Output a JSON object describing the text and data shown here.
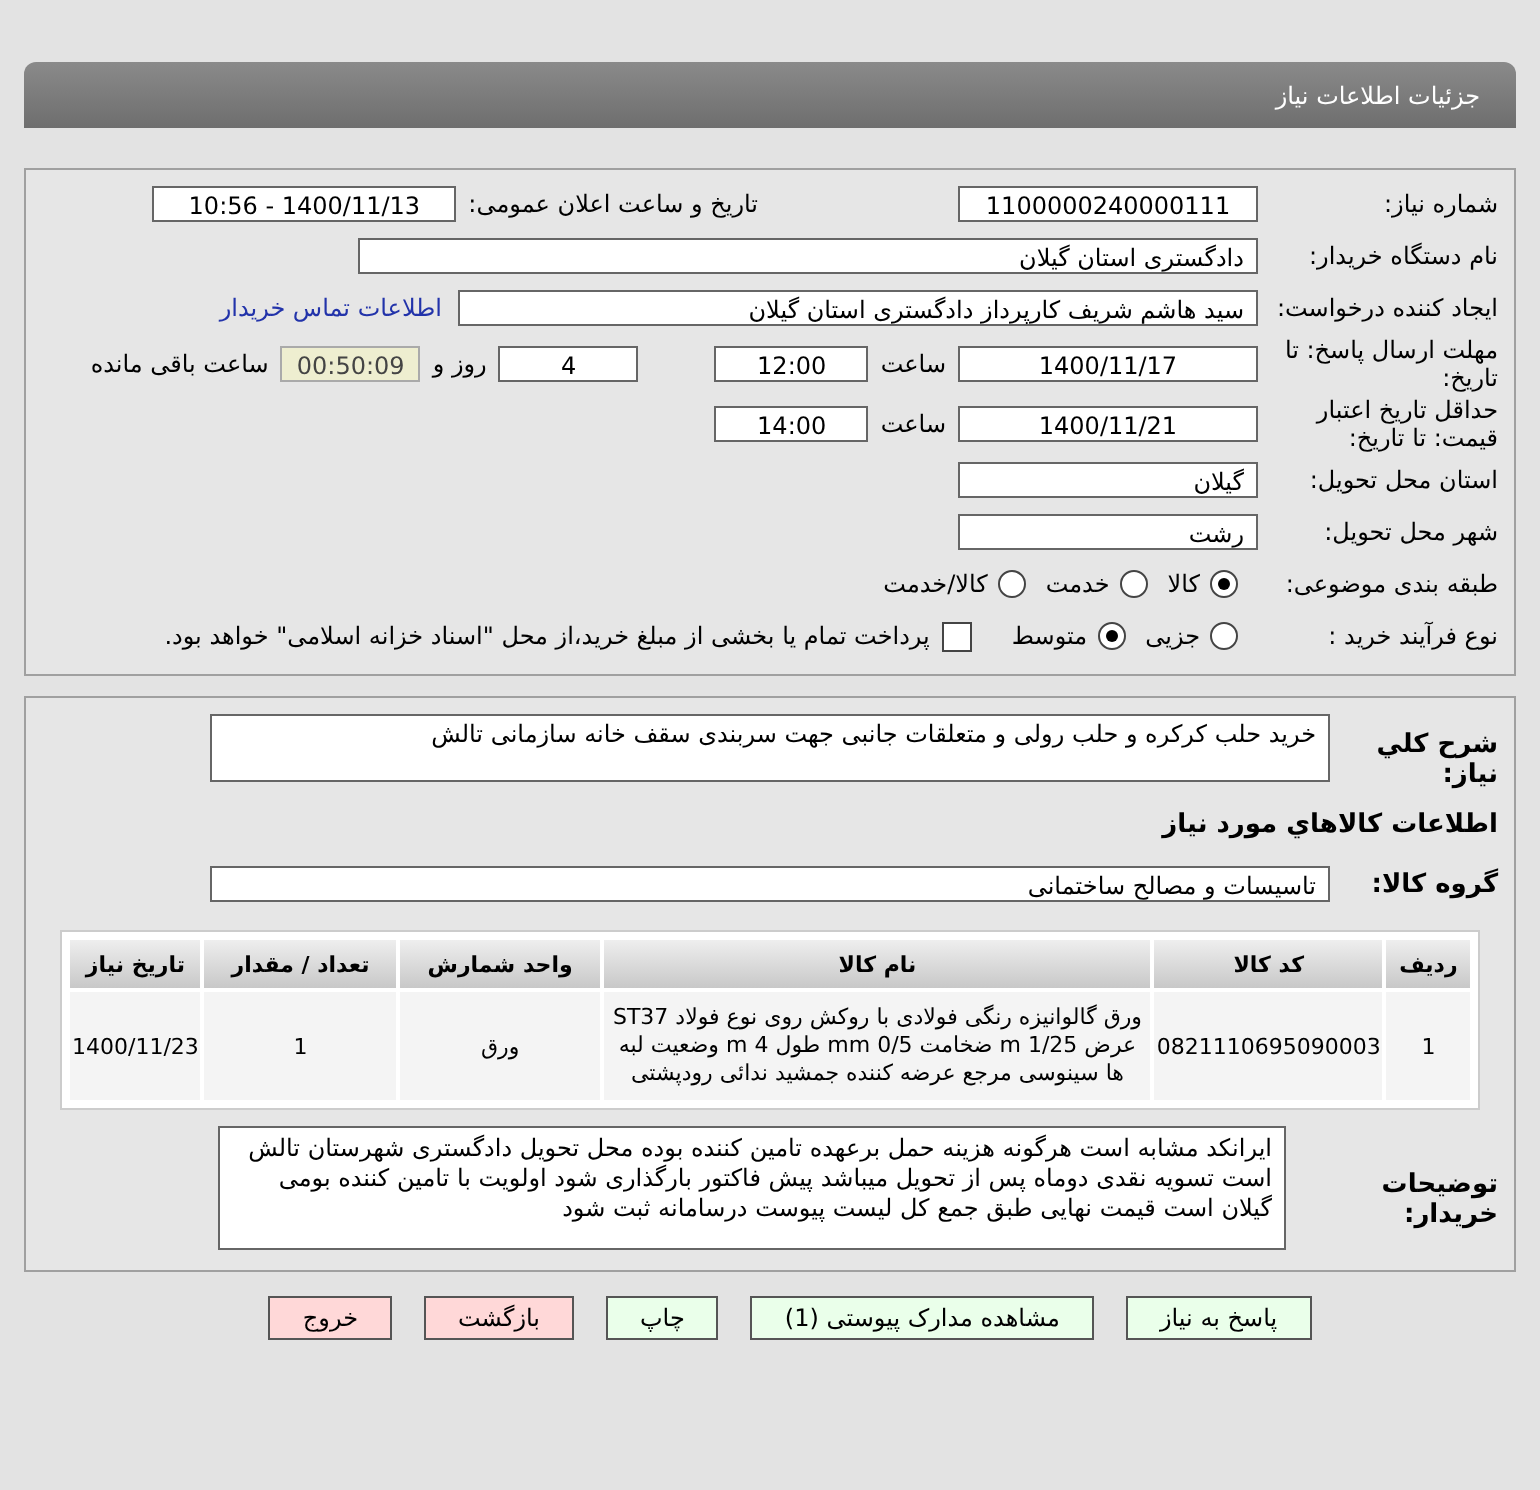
{
  "header": {
    "title": "جزئیات اطلاعات نیاز"
  },
  "details": {
    "need_number": {
      "label": "شماره نیاز:",
      "value": "1100000240000111"
    },
    "announce": {
      "label": "تاریخ و ساعت اعلان عمومی:",
      "value": "1400/11/13 - 10:56"
    },
    "buyer_org": {
      "label": "نام دستگاه خریدار:",
      "value": "دادگستری استان گیلان"
    },
    "requester": {
      "label": "ایجاد کننده درخواست:",
      "value": "سید هاشم شریف کارپرداز دادگستری استان گیلان",
      "link": "اطلاعات تماس خریدار"
    },
    "deadline": {
      "label": "مهلت ارسال پاسخ: تا تاریخ:",
      "date": "1400/11/17",
      "time_label": "ساعت",
      "time": "12:00",
      "days": "4",
      "days_label": "روز و",
      "remaining": "00:50:09",
      "remaining_label": "ساعت باقی مانده"
    },
    "validity": {
      "label": "حداقل تاریخ اعتبار قیمت: تا تاریخ:",
      "date": "1400/11/21",
      "time_label": "ساعت",
      "time": "14:00"
    },
    "province": {
      "label": "استان محل تحویل:",
      "value": "گیلان"
    },
    "city": {
      "label": "شهر محل تحویل:",
      "value": "رشت"
    },
    "category": {
      "label": "طبقه بندی موضوعی:",
      "options": [
        {
          "label": "کالا",
          "selected": true
        },
        {
          "label": "خدمت",
          "selected": false
        },
        {
          "label": "کالا/خدمت",
          "selected": false
        }
      ]
    },
    "process": {
      "label": "نوع فرآیند خرید :",
      "options": [
        {
          "label": "جزیی",
          "selected": false
        },
        {
          "label": "متوسط",
          "selected": true
        }
      ],
      "payment": {
        "checked": false,
        "text": "پرداخت تمام یا بخشی از مبلغ خرید،از محل \"اسناد خزانه اسلامی\" خواهد بود."
      }
    }
  },
  "summary": {
    "label": "شرح کلي نياز:",
    "value": "خرید حلب کرکره و حلب رولی و متعلقات جانبی جهت سربندی سقف خانه سازمانی تالش"
  },
  "goods_heading": "اطلاعات كالاهاي مورد نياز",
  "goods_group": {
    "label": "گروه کالا:",
    "value": "تاسیسات و مصالح ساختمانی"
  },
  "table": {
    "columns": [
      "ردیف",
      "کد کالا",
      "نام کالا",
      "واحد شمارش",
      "تعداد / مقدار",
      "تاریخ نیاز"
    ],
    "rows": [
      [
        "1",
        "0821110695090003",
        "ورق گالوانیزه رنگی فولادی با روکش روی نوع فولاد ST37 عرض m 1/25 ضخامت mm 0/5 طول m 4 وضعیت لبه ها سینوسی مرجع عرضه کننده جمشید ندائی رودپشتی",
        "ورق",
        "1",
        "1400/11/23"
      ]
    ]
  },
  "buyer_notes": {
    "label": "توضیحات خریدار:",
    "value": "ایرانکد مشابه است هرگونه هزینه حمل برعهده تامین کننده بوده محل تحویل دادگستری شهرستان تالش است تسویه نقدی دوماه پس از تحویل میباشد پیش فاکتور بارگذاری شود اولویت با تامین کننده بومی گیلان است قیمت نهایی طبق جمع کل لیست پیوست درسامانه ثبت شود"
  },
  "buttons": [
    {
      "label": "پاسخ به نیاز",
      "kind": "normal"
    },
    {
      "label": "مشاهده مدارک پیوستی (1)",
      "kind": "normal"
    },
    {
      "label": "چاپ",
      "kind": "normal"
    },
    {
      "label": "بازگشت",
      "kind": "danger"
    },
    {
      "label": "خروج",
      "kind": "danger"
    }
  ]
}
